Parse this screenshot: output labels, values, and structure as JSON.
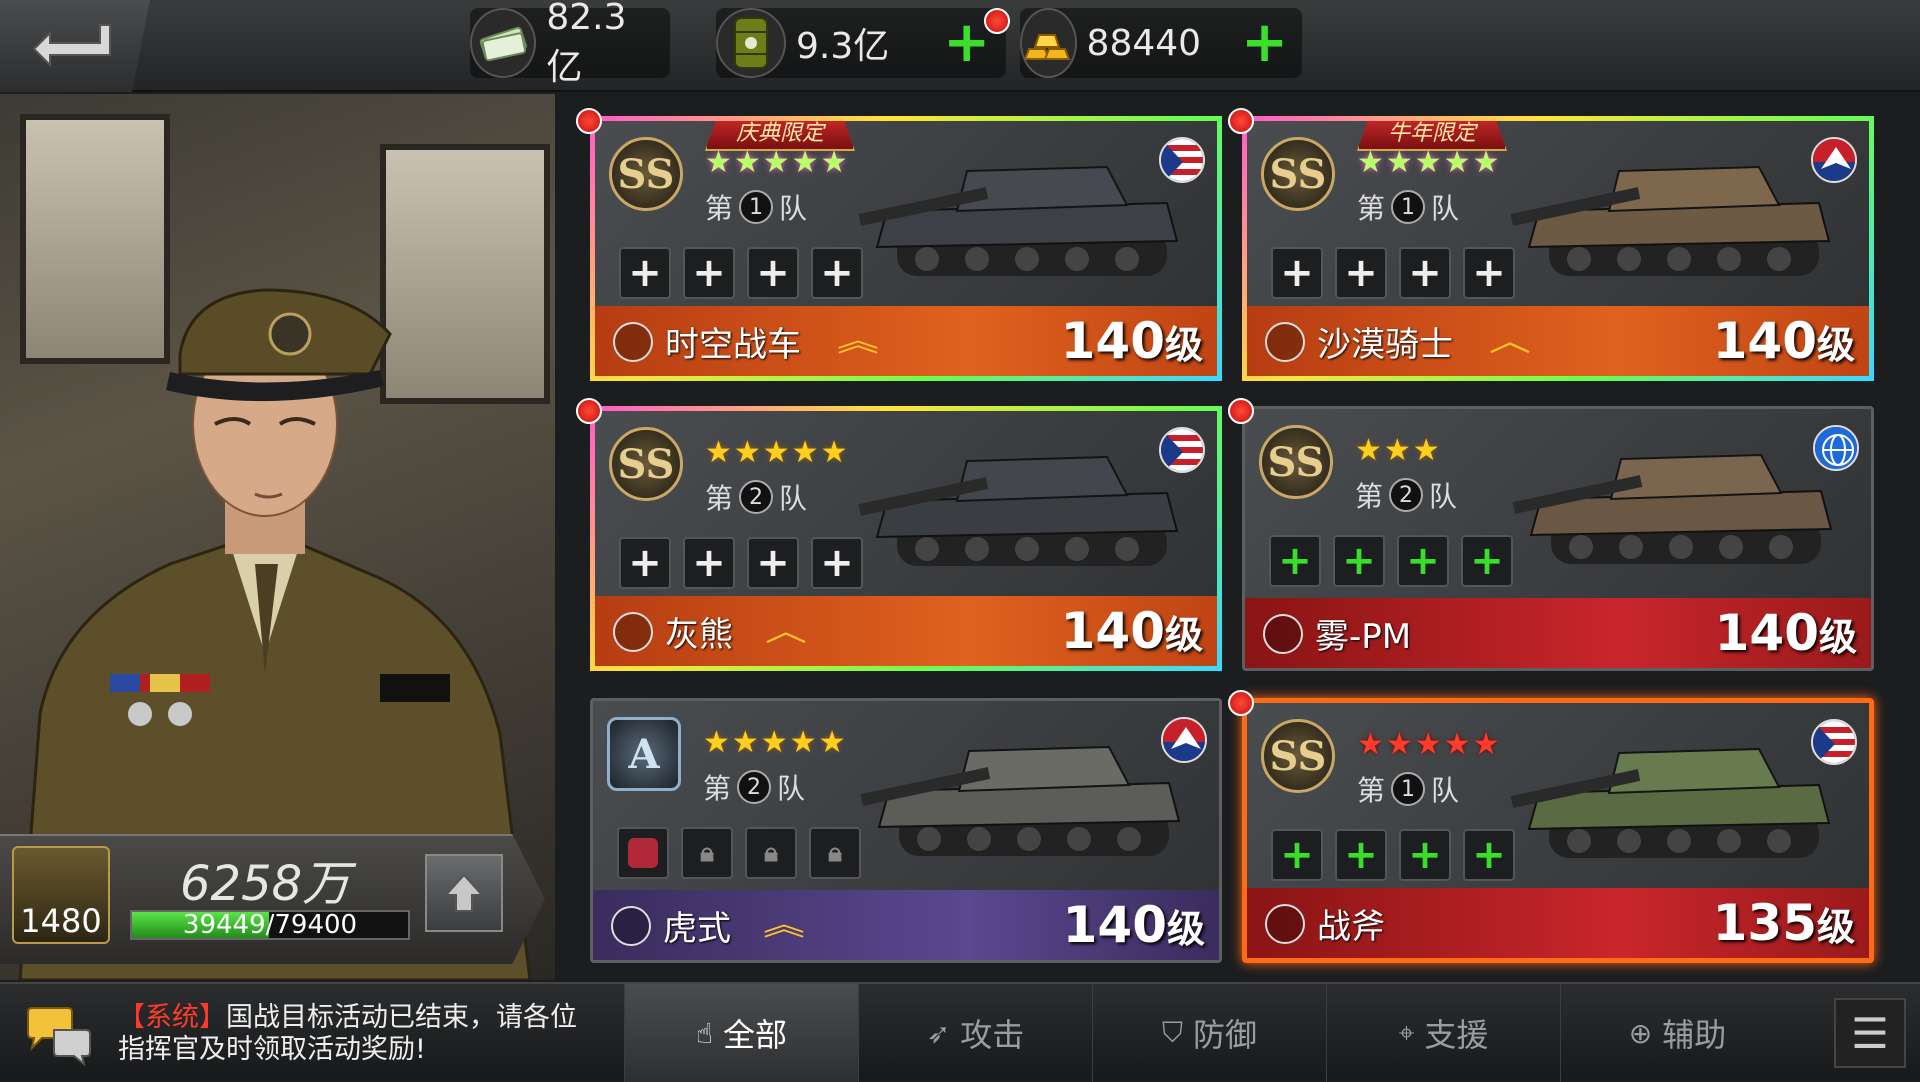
{
  "resources": [
    {
      "icon": "cash-icon",
      "value": "82.3亿"
    },
    {
      "icon": "oil-barrel-icon",
      "value": "9.3亿"
    },
    {
      "icon": "gold-bars-icon",
      "value": "88440"
    }
  ],
  "commander": {
    "level": "1480",
    "power": "6258万",
    "exp_text": "39449/79400",
    "exp_fraction": 0.497
  },
  "cards": [
    {
      "name": "时空战车",
      "level": "140",
      "level_unit": "级",
      "team_label_pre": "第",
      "team_num": "1",
      "team_label_post": "队",
      "rank": "SS",
      "stars": "★★★★★",
      "banner": "庆典限定",
      "slots": [
        "+",
        "+",
        "+",
        "+"
      ],
      "slot_style": "white",
      "strip": "orange",
      "chevron": "︽",
      "flag": "usa-flag-icon"
    },
    {
      "name": "沙漠骑士",
      "level": "140",
      "level_unit": "级",
      "team_label_pre": "第",
      "team_num": "1",
      "team_label_post": "队",
      "rank": "SS",
      "stars": "★★★★★",
      "banner": "牛年限定",
      "slots": [
        "+",
        "+",
        "+",
        "+"
      ],
      "slot_style": "white",
      "strip": "orange",
      "chevron": "︿",
      "flag": "eagle-faction-icon"
    },
    {
      "name": "灰熊",
      "level": "140",
      "level_unit": "级",
      "team_label_pre": "第",
      "team_num": "2",
      "team_label_post": "队",
      "rank": "SS",
      "stars": "★★★★★",
      "banner": "",
      "slots": [
        "+",
        "+",
        "+",
        "+"
      ],
      "slot_style": "white",
      "strip": "orange",
      "chevron": "︿",
      "flag": "usa-flag-icon"
    },
    {
      "name": "雾-PM",
      "level": "140",
      "level_unit": "级",
      "team_label_pre": "第",
      "team_num": "2",
      "team_label_post": "队",
      "rank": "SS",
      "stars": "★★★",
      "banner": "",
      "slots": [
        "+",
        "+",
        "+",
        "+"
      ],
      "slot_style": "green",
      "strip": "red",
      "chevron": "",
      "flag": "globe-faction-icon"
    },
    {
      "name": "虎式",
      "level": "140",
      "level_unit": "级",
      "team_label_pre": "第",
      "team_num": "2",
      "team_label_post": "队",
      "rank": "A",
      "stars": "★★★★★",
      "banner": "",
      "slots": [
        "item",
        "lock",
        "lock",
        "lock"
      ],
      "slot_style": "locked",
      "strip": "purple",
      "chevron": "︽",
      "flag": "eagle-faction-icon"
    },
    {
      "name": "战斧",
      "level": "135",
      "level_unit": "级",
      "team_label_pre": "第",
      "team_num": "1",
      "team_label_post": "队",
      "rank": "SS",
      "stars": "★★★★★",
      "banner": "",
      "slots": [
        "+",
        "+",
        "+",
        "+"
      ],
      "slot_style": "green",
      "strip": "red",
      "chevron": "",
      "flag": "usa-flag-icon"
    }
  ],
  "chat": {
    "tag": "【系统】",
    "message": "国战目标活动已结束，请各位指挥官及时领取活动奖励!"
  },
  "tabs": [
    {
      "icon": "hand-icon",
      "label": "全部",
      "active": true
    },
    {
      "icon": "rocket-icon",
      "label": "攻击",
      "active": false
    },
    {
      "icon": "shield-icon",
      "label": "防御",
      "active": false
    },
    {
      "icon": "crosshair-icon",
      "label": "支援",
      "active": false
    },
    {
      "icon": "plus-circle-icon",
      "label": "辅助",
      "active": false
    }
  ],
  "colors": {
    "accent_green": "#3adf2a",
    "accent_red": "#e01a1a",
    "gold": "#ffc62a"
  }
}
